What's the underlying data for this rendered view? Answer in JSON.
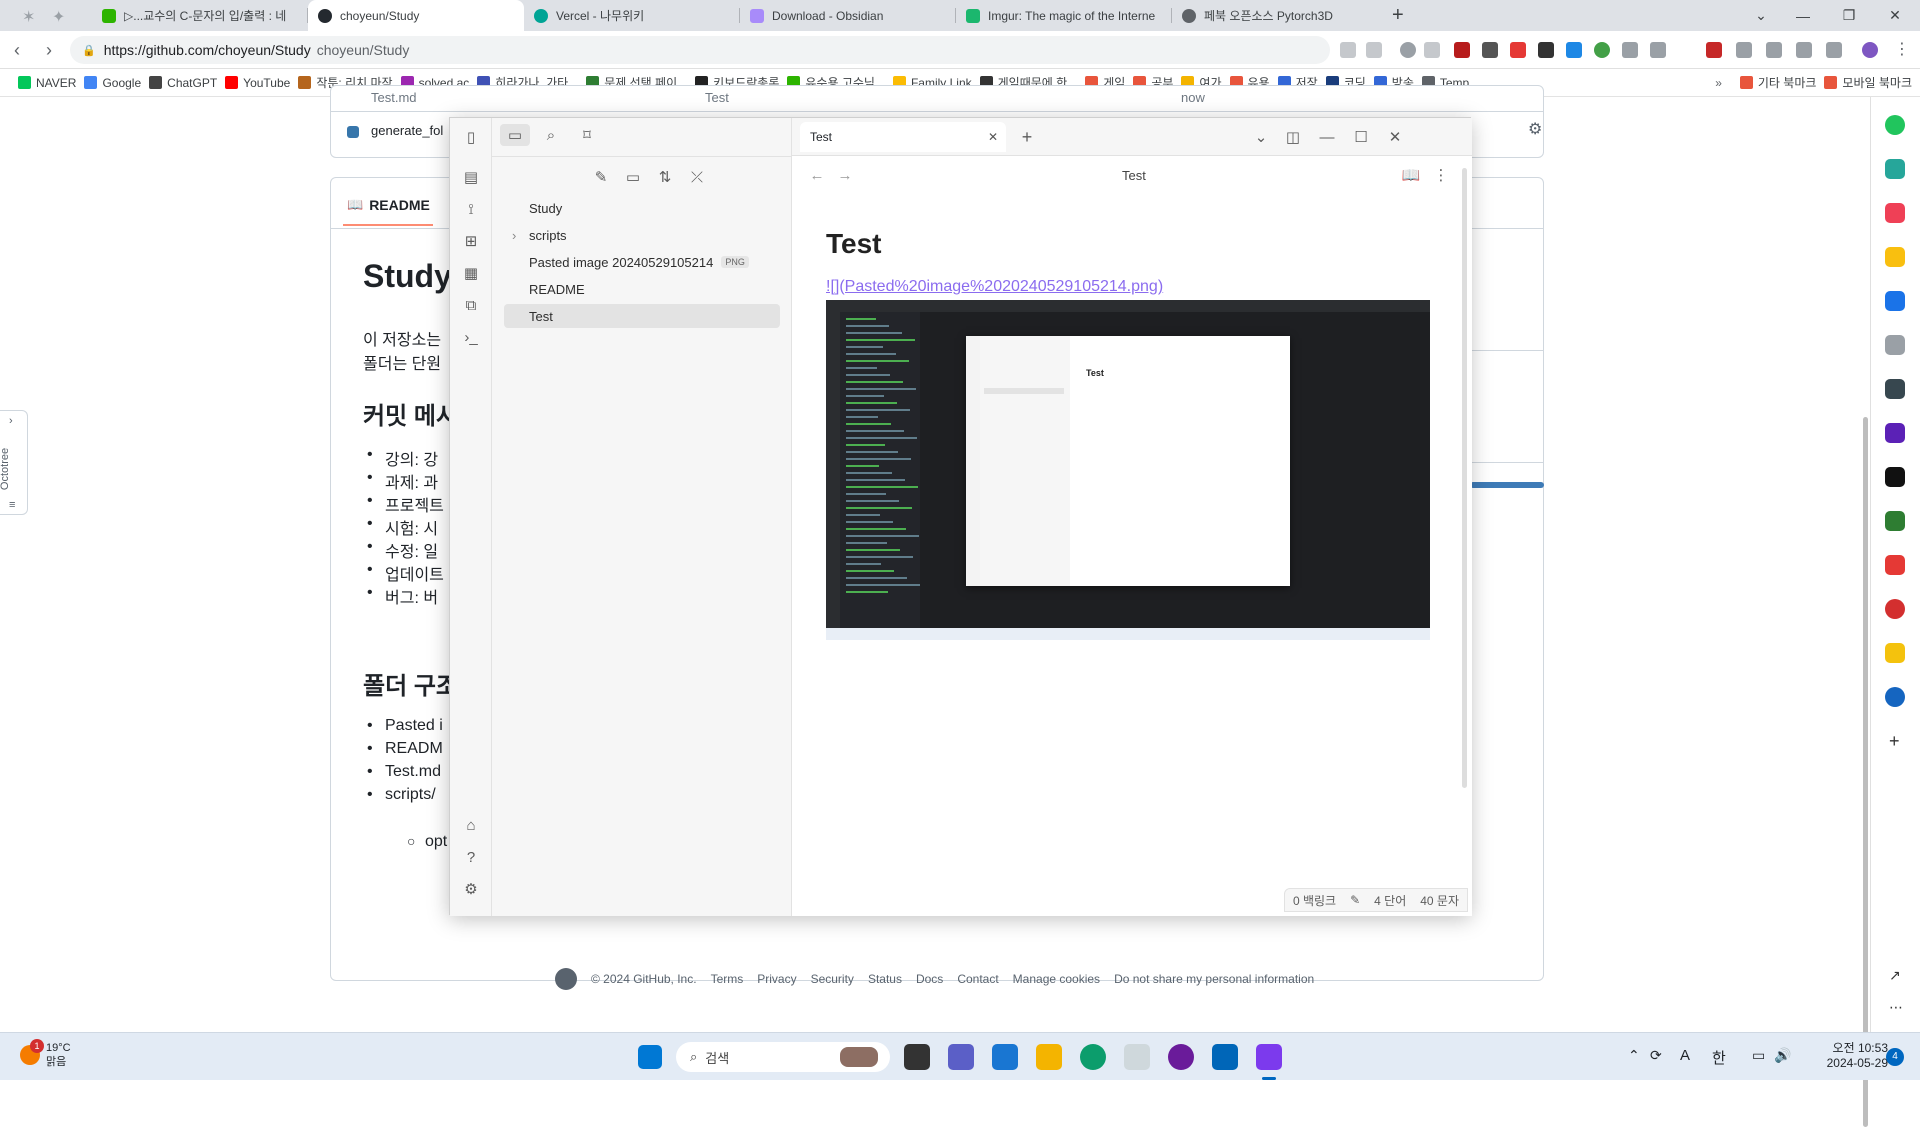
{
  "browser": {
    "tabs": [
      {
        "title": "▷...교수의 C-문자의 입/출력 : 네",
        "color": "#2db400"
      },
      {
        "title": "choyeun/Study",
        "color": "#24292f"
      },
      {
        "title": "Vercel - 나무위키",
        "color": "#00a495"
      },
      {
        "title": "Download - Obsidian",
        "color": "#a88bfa"
      },
      {
        "title": "Imgur: The magic of the Interne",
        "color": "#1bb76e"
      },
      {
        "title": "페북 오픈소스 Pytorch3D",
        "color": "#5f6368"
      }
    ],
    "new_tab": "+",
    "url": "https://github.com/choyeun/Study",
    "page_title": "choyeun/Study"
  },
  "bookmarks": [
    {
      "label": "NAVER",
      "color": "#03c75a"
    },
    {
      "label": "Google",
      "color": "#4285f4"
    },
    {
      "label": "ChatGPT",
      "color": "#444444"
    },
    {
      "label": "YouTube",
      "color": "#ff0000"
    },
    {
      "label": "작툰: 리치 마작",
      "color": "#b5651d"
    },
    {
      "label": "solved.ac",
      "color": "#9c27b0"
    },
    {
      "label": "히라가나, 가타...",
      "color": "#3f51b5"
    },
    {
      "label": "문제 선택 페이...",
      "color": "#2e7d32"
    },
    {
      "label": "키보드락총론",
      "color": "#222222"
    },
    {
      "label": "유수용 고수님...",
      "color": "#2db400"
    },
    {
      "label": "Family Link",
      "color": "#fbbc04"
    },
    {
      "label": "게임때문에 한...",
      "color": "#333333"
    },
    {
      "label": "게임",
      "color": "#e8553c"
    },
    {
      "label": "공부",
      "color": "#e8553c"
    },
    {
      "label": "여가",
      "color": "#f4b400"
    },
    {
      "label": "유용",
      "color": "#e8553c"
    },
    {
      "label": "저장",
      "color": "#3367d6"
    },
    {
      "label": "코딩",
      "color": "#1a3d7c"
    },
    {
      "label": "방송",
      "color": "#3367d6"
    },
    {
      "label": "Temp",
      "color": "#5f6368"
    }
  ],
  "bookmarks_right": [
    {
      "label": "기타 북마크",
      "color": "#e8553c"
    },
    {
      "label": "모바일 북마크",
      "color": "#e8553c"
    }
  ],
  "github": {
    "file_rows": [
      {
        "name": "Test.md",
        "commit": "Test",
        "time": "now"
      },
      {
        "name": "generate_fol"
      }
    ],
    "readme_tab": "README",
    "readme_title": "Study",
    "intro_lines": [
      "이 저장소는",
      "폴더는 단원"
    ],
    "commit_heading": "커밋 메시",
    "commit_items": [
      "강의: 강",
      "과제: 과",
      "프로젝트",
      "시험: 시",
      "수정: 일",
      "업데이트",
      "버그: 버"
    ],
    "folder_heading": "폴더 구조",
    "folder_items": [
      "Pasted i",
      "READM",
      "Test.md",
      "scripts/"
    ],
    "folder_sub": [
      "opt"
    ],
    "footer": [
      "© 2024 GitHub, Inc.",
      "Terms",
      "Privacy",
      "Security",
      "Status",
      "Docs",
      "Contact",
      "Manage cookies",
      "Do not share my personal information"
    ]
  },
  "octotree": "Octotree",
  "obsidian": {
    "vault": "Study",
    "files": [
      {
        "name": "scripts",
        "folder": true
      },
      {
        "name": "Pasted image 20240529105214",
        "ext": "PNG"
      },
      {
        "name": "README"
      },
      {
        "name": "Test",
        "selected": true
      }
    ],
    "tab_title": "Test",
    "view_title": "Test",
    "note_title": "Test",
    "note_link": "![](Pasted%20image%2020240529105214.png)",
    "screenshot_inner_title": "Test",
    "status": {
      "backlinks": "0 백링크",
      "words": "4 단어",
      "chars": "40 문자"
    }
  },
  "taskbar": {
    "weather_temp": "19°C",
    "weather_desc": "맑음",
    "weather_badge": "1",
    "search_placeholder": "검색",
    "time": "오전 10:53",
    "date": "2024-05-29",
    "notif_count": "4",
    "ime_a": "A",
    "ime_lang": "한"
  },
  "colors": {
    "obsidian_accent": "#8b6cef",
    "github_orange": "#fd8c73"
  }
}
